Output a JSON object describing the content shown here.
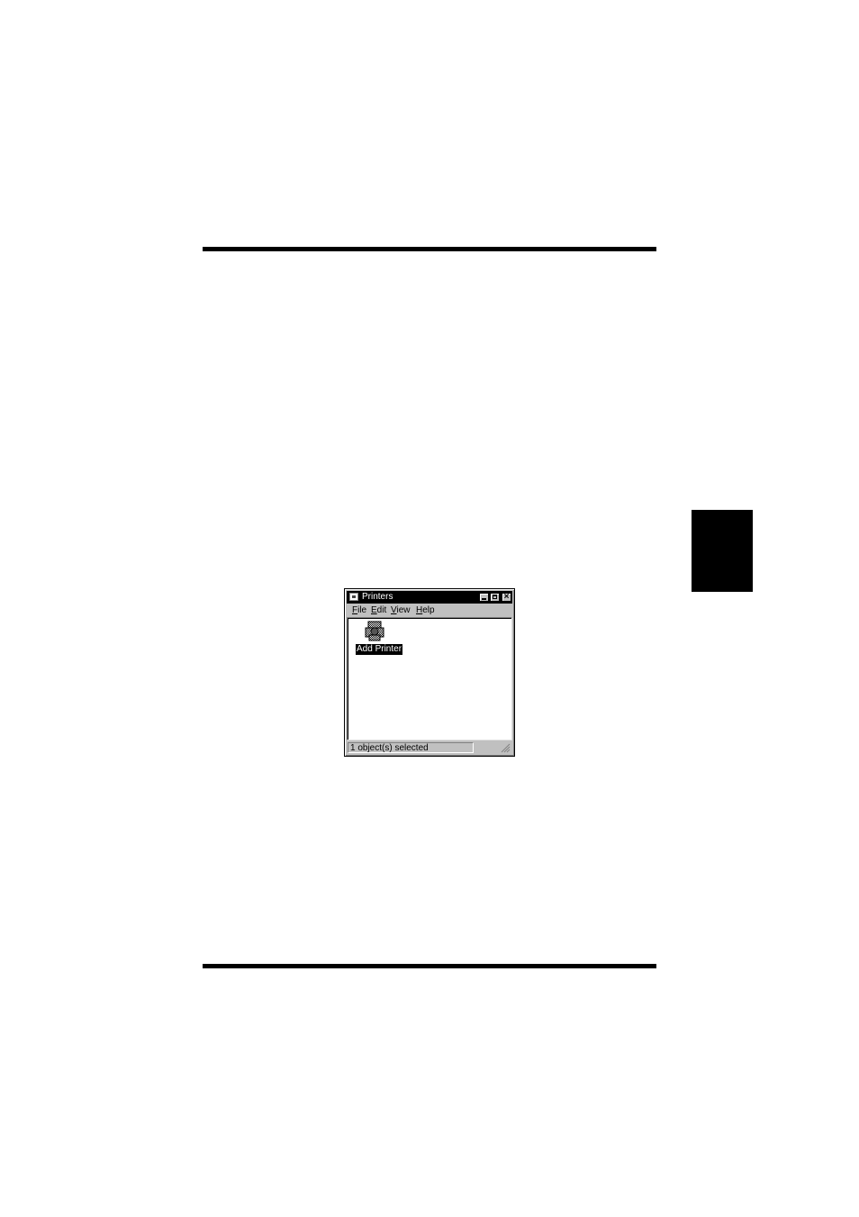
{
  "window": {
    "title": "Printers",
    "title_icon": "printers-folder-icon",
    "close_glyph": "×"
  },
  "menu": {
    "file": {
      "accel": "F",
      "rest": "ile"
    },
    "edit": {
      "accel": "E",
      "rest": "dit"
    },
    "view": {
      "accel": "V",
      "rest": "iew"
    },
    "help": {
      "accel": "H",
      "rest": "elp"
    }
  },
  "items": [
    {
      "label": "Add Printer",
      "icon": "add-printer-icon",
      "selected": true
    }
  ],
  "status": {
    "text": "1 object(s) selected"
  }
}
